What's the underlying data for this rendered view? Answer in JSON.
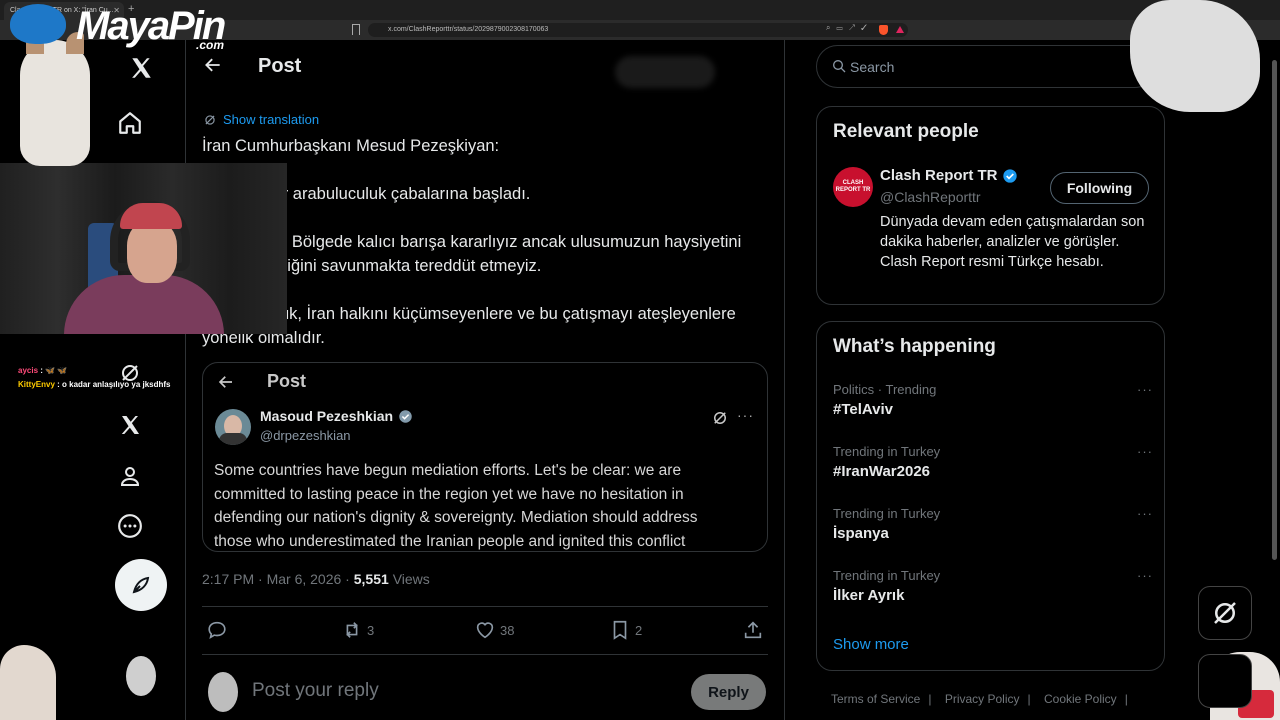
{
  "browser": {
    "tab_title": "Clash Report TR on X: \"İran Cu...",
    "url": "x.com/ClashReporttr/status/2029879002308170063"
  },
  "overlay": {
    "logo_text": "MayaPin",
    "logo_suffix": ".com",
    "chat": [
      {
        "user": "aycis",
        "message": "🦋 🦋"
      },
      {
        "user": "KittyEnvy",
        "message": "o kadar anlaşılıyo ya jksdhfs"
      }
    ]
  },
  "header": {
    "title": "Post"
  },
  "tweet": {
    "show_translation": "Show translation",
    "lines": [
      "İran Cumhurbaşkanı Mesud Pezeşkiyan:",
      "Bazı ülkeler arabuluculuk çabalarına başladı.",
      "Açık olalım: Bölgede kalıcı barışa kararlıyız ancak ulusumuzun haysiyetini",
      "ve egemenliğini savunmakta tereddüt etmeyiz.",
      "Arabuluculuk, İran halkını küçümseyenlere ve bu çatışmayı ateşleyenlere",
      "yönelik olmalıdır."
    ],
    "timestamp": "2:17 PM · Mar 6, 2026",
    "dot": " · ",
    "views_count": "5,551",
    "views_label": "Views",
    "counts": {
      "retweets": "3",
      "likes": "38",
      "bookmarks": "2"
    }
  },
  "embed": {
    "title": "Post",
    "name": "Masoud Pezeshkian",
    "handle": "@drpezeshkian",
    "text": [
      "Some countries have begun mediation efforts. Let's be clear: we are",
      "committed to lasting peace in the region yet we have no hesitation in",
      "defending our nation's dignity & sovereignty. Mediation should address",
      "those who underestimated the Iranian people and ignited this conflict"
    ]
  },
  "reply": {
    "placeholder": "Post your reply",
    "button": "Reply"
  },
  "search": {
    "placeholder": "Search"
  },
  "relevant_people": {
    "heading": "Relevant people",
    "avatar_text": "CLASH REPORT TR",
    "name": "Clash Report TR",
    "handle": "@ClashReporttr",
    "follow_label": "Following",
    "bio": "Dünyada devam eden çatışmalardan son dakika haberler, analizler ve görüşler. Clash Report resmi Türkçe hesabı."
  },
  "whats_happening": {
    "heading": "What’s happening",
    "trends": [
      {
        "meta": "Politics · Trending",
        "name": "#TelAviv"
      },
      {
        "meta": "Trending in Turkey",
        "name": "#IranWar2026"
      },
      {
        "meta": "Trending in Turkey",
        "name": "İspanya"
      },
      {
        "meta": "Trending in Turkey",
        "name": "İlker Ayrık"
      }
    ],
    "more": "···",
    "show_more": "Show more"
  },
  "footer": {
    "links": [
      "Terms of Service",
      "Privacy Policy",
      "Cookie Policy"
    ],
    "pipe": "|"
  },
  "colors": {
    "accent": "#1d9bf0",
    "background": "#000000",
    "border": "#2f3336",
    "muted": "#71767b"
  }
}
